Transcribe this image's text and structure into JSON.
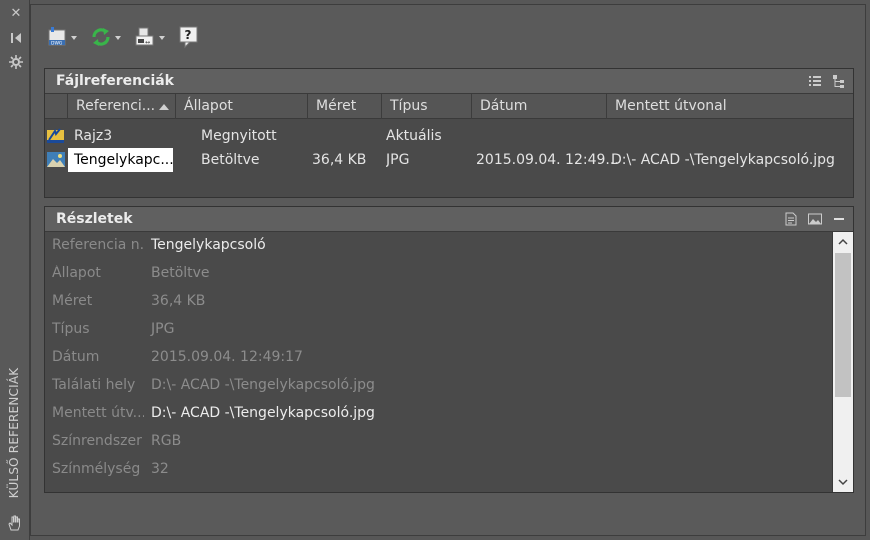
{
  "side": {
    "title": "KÜLSŐ REFERENCIÁK"
  },
  "files_panel": {
    "title": "Fájlreferenciák",
    "columns": [
      "Referenci...",
      "Állapot",
      "Méret",
      "Típus",
      "Dátum",
      "Mentett útvonal"
    ],
    "rows": [
      {
        "name": "Rajz3",
        "status": "Megnyitott",
        "size": "",
        "type": "Aktuális",
        "date": "",
        "path": ""
      },
      {
        "name": "Tengelykapc...",
        "status": "Betöltve",
        "size": "36,4 KB",
        "type": "JPG",
        "date": "2015.09.04. 12:49...",
        "path": "D:\\- ACAD -\\Tengelykapcsoló.jpg"
      }
    ]
  },
  "details_panel": {
    "title": "Részletek",
    "rows": [
      {
        "label": "Referencia n...",
        "value": "Tengelykapcsoló"
      },
      {
        "label": "Állapot",
        "value": "Betöltve"
      },
      {
        "label": "Méret",
        "value": "36,4 KB"
      },
      {
        "label": "Típus",
        "value": "JPG"
      },
      {
        "label": "Dátum",
        "value": "2015.09.04. 12:49:17"
      },
      {
        "label": "Találati hely",
        "value": "D:\\- ACAD -\\Tengelykapcsoló.jpg"
      },
      {
        "label": "Mentett útv...",
        "value": "D:\\- ACAD -\\Tengelykapcsoló.jpg"
      },
      {
        "label": "Színrendszer",
        "value": "RGB"
      },
      {
        "label": "Színmélység",
        "value": "32"
      }
    ]
  },
  "colors": {
    "background": "#575757",
    "panel": "#4a4a4a",
    "header": "#606060",
    "selection": "#ffffff",
    "refresh_green": "#39b54a"
  }
}
